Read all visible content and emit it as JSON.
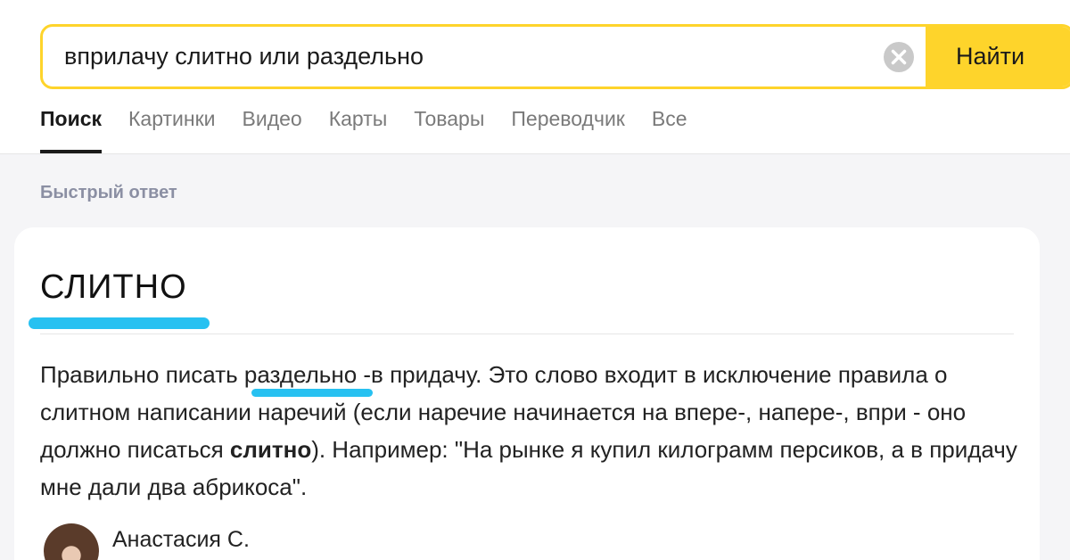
{
  "search": {
    "query": "вприлачу слитно или раздельно",
    "submit_label": "Найти",
    "clear_icon": "clear-icon",
    "accent_color": "#fed42b"
  },
  "tabs": [
    {
      "label": "Поиск",
      "active": true
    },
    {
      "label": "Картинки",
      "active": false
    },
    {
      "label": "Видео",
      "active": false
    },
    {
      "label": "Карты",
      "active": false
    },
    {
      "label": "Товары",
      "active": false
    },
    {
      "label": "Переводчик",
      "active": false
    },
    {
      "label": "Все",
      "active": false
    }
  ],
  "quick_answer": {
    "section_label": "Быстрый ответ",
    "title": "СЛИТНО",
    "text_parts": {
      "p1": "Правильно писать ",
      "p2": "раздельно - ",
      "p3": "в придачу. Это слово входит в исключение правила о слитном написании наречий (если наречие начинается на впере-, напере-, впри - оно должно писаться ",
      "p4": "слитно",
      "p5": "). Например: \"На рынке я купил килограмм персиков, а в придачу мне дали два абрикоса\"."
    },
    "highlight_color": "#27c1f1",
    "author": {
      "name": "Анастасия С.",
      "avatar": "avatar-photo"
    }
  }
}
